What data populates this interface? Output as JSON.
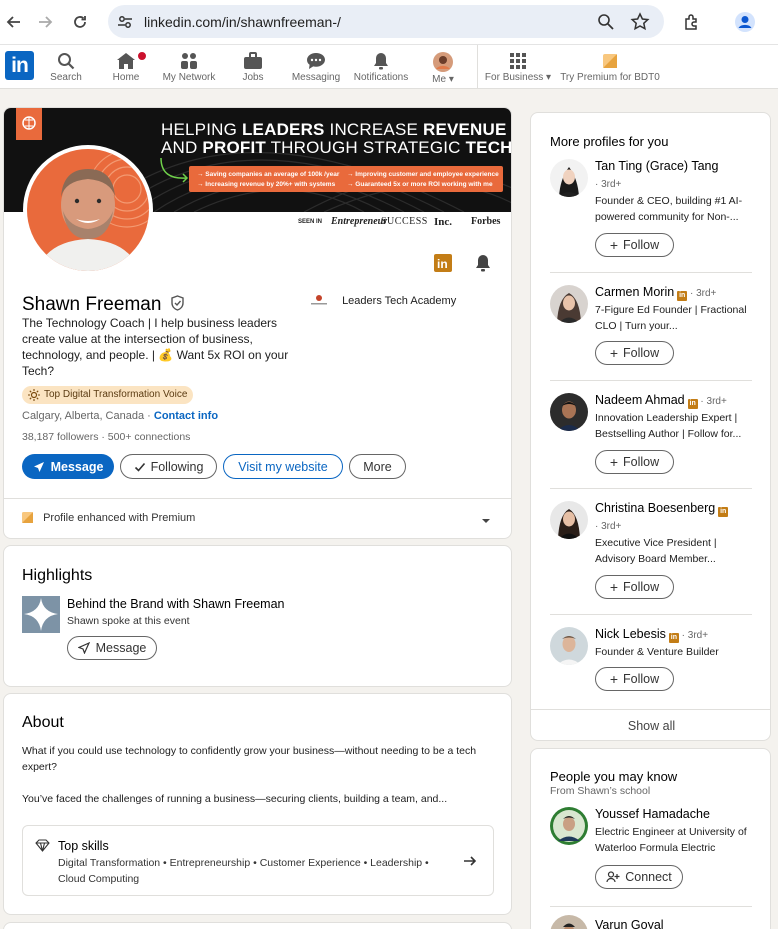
{
  "browser": {
    "url": "linkedin.com/in/shawnfreeman-/"
  },
  "nav": {
    "search": "Search",
    "home": "Home",
    "network": "My Network",
    "jobs": "Jobs",
    "messaging": "Messaging",
    "notifications": "Notifications",
    "me": "Me",
    "business": "For Business",
    "premium": "Try Premium for BDT0"
  },
  "banner": {
    "line1a": "HELPING ",
    "line1b": "LEADERS",
    "line1c": " INCREASE ",
    "line1d": "REVENUE",
    "line2a": "AND ",
    "line2b": "PROFIT",
    "line2c": " THROUGH STRATEGIC ",
    "line2d": "TECH.",
    "b1": "→ Saving companies an average of 100k /year",
    "b2": "→ Improving customer and employee experience",
    "b3": "→ Increasing revenue by 20%+ with systems",
    "b4": "→ Guaranteed 5x or more ROI working with me",
    "seen_in": "SEEN IN",
    "m1": "Entrepreneur",
    "m2": "SUCCESS",
    "m3": "Inc.",
    "m4": "Forbes"
  },
  "profile": {
    "name": "Shawn Freeman",
    "headline": "The Technology Coach | I help business leaders create value at the intersection of business, technology, and people. | 💰 Want 5x ROI on your Tech?",
    "voice": "Top Digital Transformation Voice",
    "location": "Calgary, Alberta, Canada · ",
    "contact": "Contact info",
    "followers": "38,187 followers",
    "connections": " · 500+ connections",
    "company": "Leaders Tech Academy",
    "btn_message": "Message",
    "btn_following": "Following",
    "btn_website": "Visit my website",
    "btn_more": "More",
    "premium_note": "Profile enhanced with Premium"
  },
  "highlights": {
    "title": "Highlights",
    "item_title": "Behind the Brand with Shawn Freeman",
    "item_sub": "Shawn spoke at this event",
    "btn": "Message"
  },
  "about": {
    "title": "About",
    "p1": "What if you could use technology to confidently grow your business—without needing to be a tech expert?",
    "p2": "You’ve faced the challenges of running a business—securing clients, building a team, and...",
    "skills_title": "Top skills",
    "skills": "Digital Transformation • Entrepreneurship • Customer Experience • Leadership • Cloud Computing"
  },
  "sidebar": {
    "title": "More profiles for you",
    "follow": "Follow",
    "show_all": "Show all",
    "people": [
      {
        "name": "Tan Ting (Grace) Tang",
        "degree": "· 3rd+",
        "desc": "Founder & CEO, building #1 AI-powered community for Non-..."
      },
      {
        "name": "Carmen Morin",
        "degree": " · 3rd+",
        "desc": "7-Figure Ed Founder | Fractional CLO | Turn your..."
      },
      {
        "name": "Nadeem Ahmad",
        "degree": " · 3rd+",
        "desc": "Innovation Leadership Expert | Bestselling Author | Follow for..."
      },
      {
        "name": "Christina Boesenberg",
        "degree": "· 3rd+",
        "desc": "Executive Vice President | Advisory Board Member..."
      },
      {
        "name": "Nick Lebesis",
        "degree": " · 3rd+",
        "desc": "Founder & Venture Builder"
      }
    ]
  },
  "pymk": {
    "title": "People you may know",
    "sub": "From Shawn’s school",
    "p1_name": "Youssef Hamadache",
    "p1_desc": "Electric Engineer at University of Waterloo Formula Electric",
    "connect": "Connect",
    "p2_name": "Varun Goyal"
  }
}
